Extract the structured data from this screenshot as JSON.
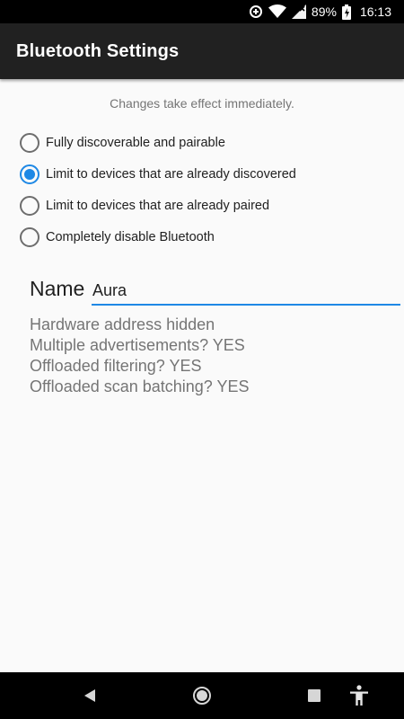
{
  "status_bar": {
    "battery": "89%",
    "time": "16:13",
    "icons": [
      "data-saver-icon",
      "wifi-icon",
      "cellular-signal-icon",
      "battery-charging-icon"
    ]
  },
  "app_bar": {
    "title": "Bluetooth Settings"
  },
  "hint": "Changes take effect immediately.",
  "options": [
    {
      "label": "Fully discoverable and pairable",
      "checked": false
    },
    {
      "label": "Limit to devices that are already discovered",
      "checked": true
    },
    {
      "label": "Limit to devices that are already paired",
      "checked": false
    },
    {
      "label": "Completely disable Bluetooth",
      "checked": false
    }
  ],
  "name_field": {
    "label": "Name",
    "value": "Aura"
  },
  "info": [
    "Hardware address hidden",
    "Multiple advertisements? YES",
    "Offloaded filtering? YES",
    "Offloaded scan batching? YES"
  ],
  "nav_bar": {
    "icons": [
      "back-icon",
      "home-icon",
      "recents-icon",
      "accessibility-icon"
    ]
  },
  "colors": {
    "accent": "#1e88e5",
    "app_bar": "#212121",
    "background": "#fafafa"
  }
}
